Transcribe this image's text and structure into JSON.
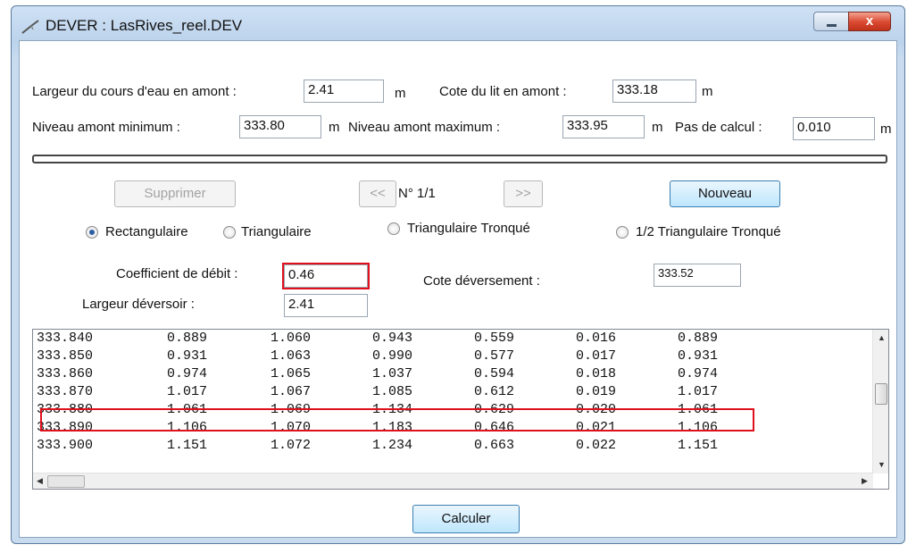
{
  "window": {
    "title": "DEVER : LasRives_reel.DEV",
    "close_glyph": "x"
  },
  "params": {
    "largeur_amont_label": "Largeur du cours d'eau en amont :",
    "largeur_amont_value": "2.41",
    "unit": "m",
    "cote_lit_label": "Cote du lit en amont :",
    "cote_lit_value": "333.18",
    "niveau_min_label": "Niveau amont minimum :",
    "niveau_min_value": "333.80",
    "niveau_max_label": "Niveau amont maximum :",
    "niveau_max_value": "333.95",
    "pas_label": "Pas de calcul :",
    "pas_value": "0.010"
  },
  "nav": {
    "supprimer": "Supprimer",
    "prev": "<<",
    "counter": "N° 1/1",
    "next": ">>",
    "nouveau": "Nouveau"
  },
  "shapes": {
    "rect": "Rectangulaire",
    "tri": "Triangulaire",
    "tri_tronque": "Triangulaire Tronqué",
    "half_tri_tronque": "1/2 Triangulaire Tronqué",
    "selected": "Rectangulaire"
  },
  "weir": {
    "coef_label": "Coefficient de débit :",
    "coef_value": "0.46",
    "cote_dev_label": "Cote déversement :",
    "cote_dev_value": "333.52",
    "largeur_dev_label": "Largeur déversoir :",
    "largeur_dev_value": "2.41"
  },
  "results": {
    "rows": [
      [
        "333.840",
        "0.889",
        "1.060",
        "0.943",
        "0.559",
        "0.016",
        "0.889"
      ],
      [
        "333.850",
        "0.931",
        "1.063",
        "0.990",
        "0.577",
        "0.017",
        "0.931"
      ],
      [
        "333.860",
        "0.974",
        "1.065",
        "1.037",
        "0.594",
        "0.018",
        "0.974"
      ],
      [
        "333.870",
        "1.017",
        "1.067",
        "1.085",
        "0.612",
        "0.019",
        "1.017"
      ],
      [
        "333.880",
        "1.061",
        "1.069",
        "1.134",
        "0.629",
        "0.020",
        "1.061"
      ],
      [
        "333.890",
        "1.106",
        "1.070",
        "1.183",
        "0.646",
        "0.021",
        "1.106"
      ],
      [
        "333.900",
        "1.151",
        "1.072",
        "1.234",
        "0.663",
        "0.022",
        "1.151"
      ]
    ],
    "highlighted_row": 4
  },
  "calculer": "Calculer",
  "colors": {
    "highlight": "#e0101c",
    "radio_selected": "#2d5fa6"
  }
}
